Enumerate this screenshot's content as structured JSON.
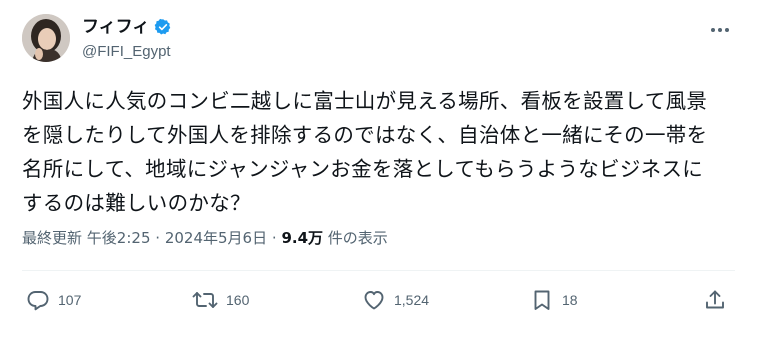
{
  "author": {
    "display_name": "フィフィ",
    "handle": "@FIFI_Egypt",
    "verified": true
  },
  "tweet": {
    "text": "外国人に人気のコンビ二越しに富士山が見える場所、看板を設置して風景\nを隠したりして外国人を排除するのではなく、自治体と一緒にその一帯を\n名所にして、地域にジャンジャンお金を落としてもらうようなビジネスに\nするのは難しいのかな？"
  },
  "meta": {
    "edited_label": "最終更新",
    "time": "午後2:25",
    "separator": "·",
    "date": "2024年5月6日",
    "views_count": "9.4万",
    "views_label": "件の表示"
  },
  "actions": {
    "reply_count": "107",
    "retweet_count": "160",
    "like_count": "1,524",
    "bookmark_count": "18"
  },
  "colors": {
    "text": "#0f1419",
    "secondary": "#536471",
    "verified": "#1d9bf0",
    "divider": "#eff3f4"
  },
  "icons": {
    "reply": "reply-icon",
    "retweet": "retweet-icon",
    "like": "heart-icon",
    "bookmark": "bookmark-icon",
    "share": "share-icon",
    "more": "more-dots-icon",
    "verified": "verified-badge-icon"
  }
}
